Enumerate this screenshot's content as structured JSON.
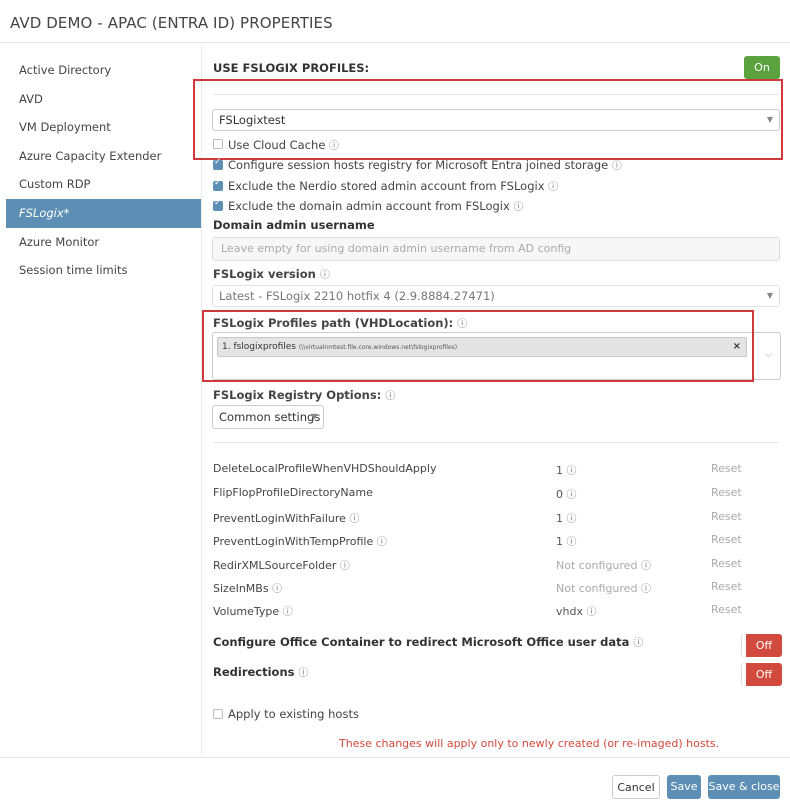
{
  "title": "AVD DEMO - APAC (ENTRA ID) PROPERTIES",
  "sidebar": {
    "items": [
      {
        "label": "Active Directory"
      },
      {
        "label": "AVD"
      },
      {
        "label": "VM Deployment"
      },
      {
        "label": "Azure Capacity Extender"
      },
      {
        "label": "Custom RDP"
      },
      {
        "label": "FSLogix*",
        "active": true
      },
      {
        "label": "Azure Monitor"
      },
      {
        "label": "Session time limits"
      }
    ]
  },
  "main": {
    "use_fslogix_label": "USE FSLOGIX PROFILES:",
    "use_fslogix_toggle": "On",
    "profile_select": "FSLogixtest",
    "use_cloud_cache": "Use Cloud Cache",
    "checkboxes": [
      "Configure session hosts registry for Microsoft Entra joined storage",
      "Exclude the Nerdio stored admin account from FSLogix",
      "Exclude the domain admin account from FSLogix"
    ],
    "domain_admin_label": "Domain admin username",
    "domain_admin_placeholder": "Leave empty for using domain admin username from AD config",
    "version_label": "FSLogix version",
    "version_value": "Latest - FSLogix 2210 hotfix 4 (2.9.8884.27471)",
    "profiles_path_label": "FSLogix Profiles path (VHDLocation):",
    "profiles_path_tag_name": "1. fslogixprofiles",
    "profiles_path_tag_path": "(\\\\virtualnmtest.file.core.windows.net\\fslogixprofiles)",
    "registry_label": "FSLogix Registry Options:",
    "registry_select": "Common settings",
    "registry_rows": [
      {
        "name": "DeleteLocalProfileWhenVHDShouldApply",
        "info": false,
        "value": "1",
        "reset": "Reset"
      },
      {
        "name": "FlipFlopProfileDirectoryName",
        "info": false,
        "value": "0",
        "reset": "Reset"
      },
      {
        "name": "PreventLoginWithFailure",
        "info": true,
        "value": "1",
        "reset": "Reset"
      },
      {
        "name": "PreventLoginWithTempProfile",
        "info": true,
        "value": "1",
        "reset": "Reset"
      },
      {
        "name": "RedirXMLSourceFolder",
        "info": true,
        "value": "Not configured",
        "reset": "Reset"
      },
      {
        "name": "SizeInMBs",
        "info": true,
        "value": "Not configured",
        "reset": "Reset"
      },
      {
        "name": "VolumeType",
        "info": true,
        "value": "vhdx",
        "reset": "Reset"
      }
    ],
    "office_container_label": "Configure Office Container to redirect Microsoft Office user data",
    "office_container_toggle": "Off",
    "redirections_label": "Redirections",
    "redirections_toggle": "Off",
    "apply_existing_label": "Apply to existing hosts",
    "warning": "These changes will apply only to newly created (or re-imaged) hosts."
  },
  "footer": {
    "cancel": "Cancel",
    "save": "Save",
    "save_close": "Save & close"
  },
  "colors": {
    "accent": "#5d8fb5",
    "on": "#5aa33f",
    "off": "#d24a3d",
    "highlight_box": "#d0383b"
  }
}
